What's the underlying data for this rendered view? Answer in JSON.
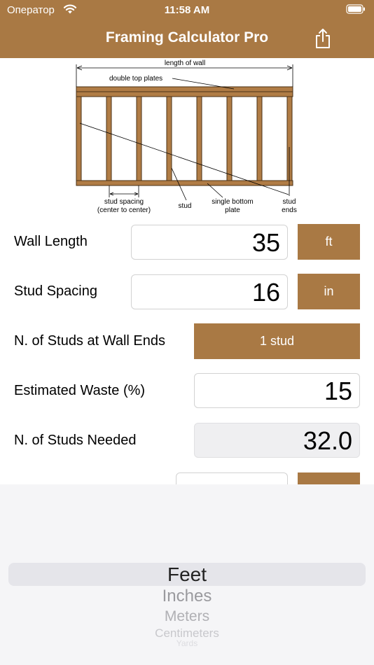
{
  "status_bar": {
    "carrier": "Оператор",
    "time": "11:58 AM"
  },
  "header": {
    "title": "Framing Calculator Pro",
    "share_icon": "share-icon"
  },
  "diagram": {
    "length_of_wall": "length of wall",
    "double_top_plates": "double top plates",
    "stud_spacing_line1": "stud spacing",
    "stud_spacing_line2": "(center to center)",
    "stud": "stud",
    "single_bottom_line1": "single bottom",
    "single_bottom_line2": "plate",
    "stud_ends_line1": "stud",
    "stud_ends_line2": "ends"
  },
  "form": {
    "wall_length": {
      "label": "Wall Length",
      "value": "35",
      "unit": "ft"
    },
    "stud_spacing": {
      "label": "Stud Spacing",
      "value": "16",
      "unit": "in"
    },
    "studs_at_ends": {
      "label": "N. of Studs at Wall Ends",
      "value": "1 stud"
    },
    "waste": {
      "label": "Estimated Waste (%)",
      "value": "15"
    },
    "studs_needed": {
      "label": "N. of Studs Needed",
      "value": "32.0"
    }
  },
  "picker": {
    "options": [
      "Feet",
      "Inches",
      "Meters",
      "Centimeters",
      "Yards"
    ],
    "selected": "Feet"
  },
  "colors": {
    "accent": "#a97944",
    "wood": "#b07c45"
  }
}
